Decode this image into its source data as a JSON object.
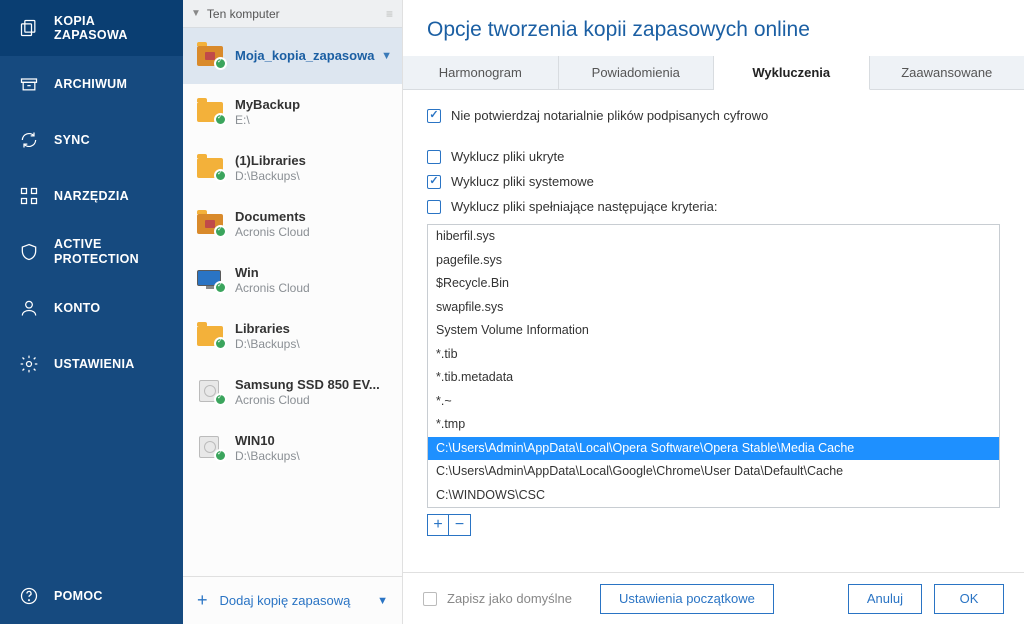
{
  "nav": {
    "items": [
      {
        "label": "KOPIA ZAPASOWA",
        "icon": "copy"
      },
      {
        "label": "ARCHIWUM",
        "icon": "archive"
      },
      {
        "label": "SYNC",
        "icon": "sync"
      },
      {
        "label": "NARZĘDZIA",
        "icon": "tools"
      },
      {
        "label": "ACTIVE PROTECTION",
        "icon": "shield"
      },
      {
        "label": "KONTO",
        "icon": "account"
      },
      {
        "label": "USTAWIENIA",
        "icon": "settings"
      }
    ],
    "help": "POMOC"
  },
  "backup_list": {
    "header": "Ten komputer",
    "items": [
      {
        "name": "Moja_kopia_zapasowa",
        "path": "",
        "type": "brief",
        "selected": true
      },
      {
        "name": "MyBackup",
        "path": "E:\\",
        "type": "folder"
      },
      {
        "name": "(1)Libraries",
        "path": "D:\\Backups\\",
        "type": "folder"
      },
      {
        "name": "Documents",
        "path": "Acronis Cloud",
        "type": "brief"
      },
      {
        "name": "Win",
        "path": "Acronis Cloud",
        "type": "monitor"
      },
      {
        "name": "Libraries",
        "path": "D:\\Backups\\",
        "type": "folder"
      },
      {
        "name": "Samsung SSD 850 EV...",
        "path": "Acronis Cloud",
        "type": "disk"
      },
      {
        "name": "WIN10",
        "path": "D:\\Backups\\",
        "type": "disk"
      }
    ],
    "add": "Dodaj kopię zapasową"
  },
  "main": {
    "title": "Opcje tworzenia kopii zapasowych online",
    "tabs": [
      "Harmonogram",
      "Powiadomienia",
      "Wykluczenia",
      "Zaawansowane"
    ],
    "active_tab": 2,
    "checks": {
      "notarize": "Nie potwierdzaj notarialnie plików podpisanych cyfrowo",
      "hidden": "Wyklucz pliki ukryte",
      "system": "Wyklucz pliki systemowe",
      "criteria": "Wyklucz pliki spełniające następujące kryteria:"
    },
    "exclusions": [
      "hiberfil.sys",
      "pagefile.sys",
      "$Recycle.Bin",
      "swapfile.sys",
      "System Volume Information",
      "*.tib",
      "*.tib.metadata",
      "*.~",
      "*.tmp",
      "C:\\Users\\Admin\\AppData\\Local\\Opera Software\\Opera Stable\\Media Cache",
      "C:\\Users\\Admin\\AppData\\Local\\Google\\Chrome\\User Data\\Default\\Cache",
      "C:\\WINDOWS\\CSC"
    ],
    "selected_exclusion": 9
  },
  "footer": {
    "save_default": "Zapisz jako domyślne",
    "initial": "Ustawienia początkowe",
    "cancel": "Anuluj",
    "ok": "OK"
  }
}
